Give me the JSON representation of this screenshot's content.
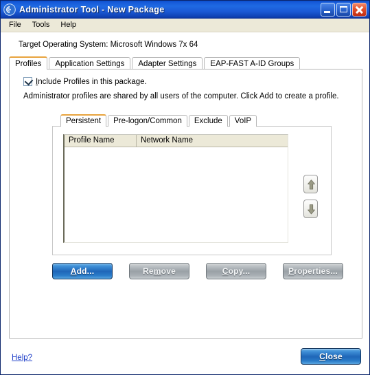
{
  "window": {
    "title": "Administrator Tool - New Package",
    "icon": "wireless-signal-icon",
    "controls": {
      "minimize": "Minimize",
      "maximize": "Maximize",
      "close": "Close"
    }
  },
  "menubar": {
    "items": [
      {
        "label": "File"
      },
      {
        "label": "Tools"
      },
      {
        "label": "Help"
      }
    ]
  },
  "main": {
    "target_os_label": "Target Operating System: Microsoft Windows 7x 64",
    "outer_tabs": [
      {
        "label": "Profiles",
        "active": true
      },
      {
        "label": "Application Settings",
        "active": false
      },
      {
        "label": "Adapter Settings",
        "active": false
      },
      {
        "label": "EAP-FAST A-ID Groups",
        "active": false
      }
    ],
    "include_checkbox": {
      "checked": true,
      "label_accel": "I",
      "label_rest": "nclude Profiles in this package."
    },
    "description": "Administrator profiles are shared by all users of the computer. Click Add to create a profile.",
    "inner_tabs": [
      {
        "label": "Persistent",
        "active": true
      },
      {
        "label": "Pre-logon/Common",
        "active": false
      },
      {
        "label": "Exclude",
        "active": false
      },
      {
        "label": "VoIP",
        "active": false
      }
    ],
    "list": {
      "columns": [
        {
          "label": "Profile Name"
        },
        {
          "label": "Network Name"
        }
      ],
      "rows": []
    },
    "order_buttons": [
      {
        "name": "move-up-button",
        "icon": "arrow-up-icon"
      },
      {
        "name": "move-down-button",
        "icon": "arrow-down-icon"
      }
    ],
    "actions": [
      {
        "name": "add-button",
        "accel": "A",
        "rest": "dd...",
        "style": "primary"
      },
      {
        "name": "remove-button",
        "accel": "m",
        "pre": "Re",
        "rest": "ove",
        "style": "grey"
      },
      {
        "name": "copy-button",
        "accel": "C",
        "rest": "opy...",
        "style": "grey"
      },
      {
        "name": "properties-button",
        "accel": "P",
        "rest": "roperties...",
        "style": "grey"
      }
    ]
  },
  "footer": {
    "help_label": "Help?",
    "close_accel": "C",
    "close_rest": "lose"
  },
  "colors": {
    "titlebar_blue": "#1f6ae2",
    "menubar_beige": "#ece9d8",
    "active_tab_accent": "#e8a33d",
    "primary_button_blue": "#1f66b8",
    "link_blue": "#1e3ec8",
    "close_button_red": "#e2502a"
  }
}
